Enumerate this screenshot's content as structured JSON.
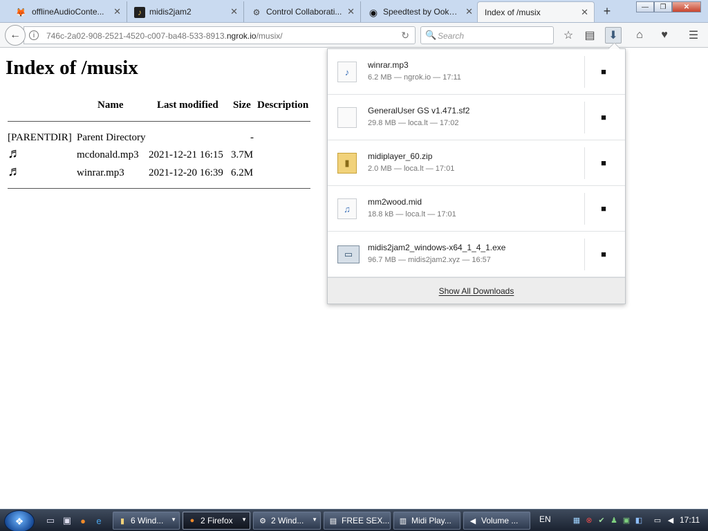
{
  "tabs": [
    {
      "label": "offlineAudioConte...",
      "icon": "fox-icon"
    },
    {
      "label": "midis2jam2",
      "icon": "sax-icon"
    },
    {
      "label": "Control Collaborati...",
      "icon": "gear-icon"
    },
    {
      "label": "Speedtest by Ookla...",
      "icon": "speedometer-icon"
    },
    {
      "label": "Index of /musix",
      "icon": "",
      "active": true
    }
  ],
  "new_tab_symbol": "+",
  "window": {
    "minimize": "—",
    "maximize": "❐",
    "close": "✕"
  },
  "nav": {
    "url_prefix": "746c-2a02-908-2521-4520-c007-ba48-533-8913.",
    "url_domain": "ngrok.io",
    "url_suffix": "/musix/",
    "search_placeholder": "Search"
  },
  "page": {
    "title": "Index of /musix",
    "headers": {
      "name": "Name",
      "modified": "Last modified",
      "size": "Size",
      "description": "Description"
    },
    "parent": {
      "type": "[PARENTDIR]",
      "name": "Parent Directory",
      "size": "-"
    },
    "files": [
      {
        "name": "mcdonald.mp3",
        "modified": "2021-12-21 16:15",
        "size": "3.7M"
      },
      {
        "name": "winrar.mp3",
        "modified": "2021-12-20 16:39",
        "size": "6.2M"
      }
    ]
  },
  "downloads": {
    "items": [
      {
        "name": "winrar.mp3",
        "meta": "6.2 MB — ngrok.io — 17:11",
        "icon": "mp3-file-icon"
      },
      {
        "name": "GeneralUser GS v1.471.sf2",
        "meta": "29.8 MB — loca.lt — 17:02",
        "icon": "blank-file-icon"
      },
      {
        "name": "midiplayer_60.zip",
        "meta": "2.0 MB — loca.lt — 17:01",
        "icon": "zip-folder-icon"
      },
      {
        "name": "mm2wood.mid",
        "meta": "18.8 kB — loca.lt — 17:01",
        "icon": "midi-file-icon"
      },
      {
        "name": "midis2jam2_windows-x64_1_4_1.exe",
        "meta": "96.7 MB — midis2jam2.xyz — 16:57",
        "icon": "exe-file-icon"
      }
    ],
    "show_all": "Show All Downloads"
  },
  "taskbar": {
    "tasks": [
      {
        "label": "6 Wind...",
        "icon": "folder-icon",
        "arrow": true
      },
      {
        "label": "2 Firefox",
        "icon": "firefox-icon",
        "arrow": true,
        "active": true
      },
      {
        "label": "2 Wind...",
        "icon": "network-icon",
        "arrow": true
      },
      {
        "label": "FREE SEX...",
        "icon": "notepad-icon",
        "arrow": false
      },
      {
        "label": "Midi Play...",
        "icon": "player-icon",
        "arrow": false
      },
      {
        "label": "Volume ...",
        "icon": "volume-icon",
        "arrow": false
      }
    ],
    "language": "EN",
    "clock": "17:11"
  }
}
